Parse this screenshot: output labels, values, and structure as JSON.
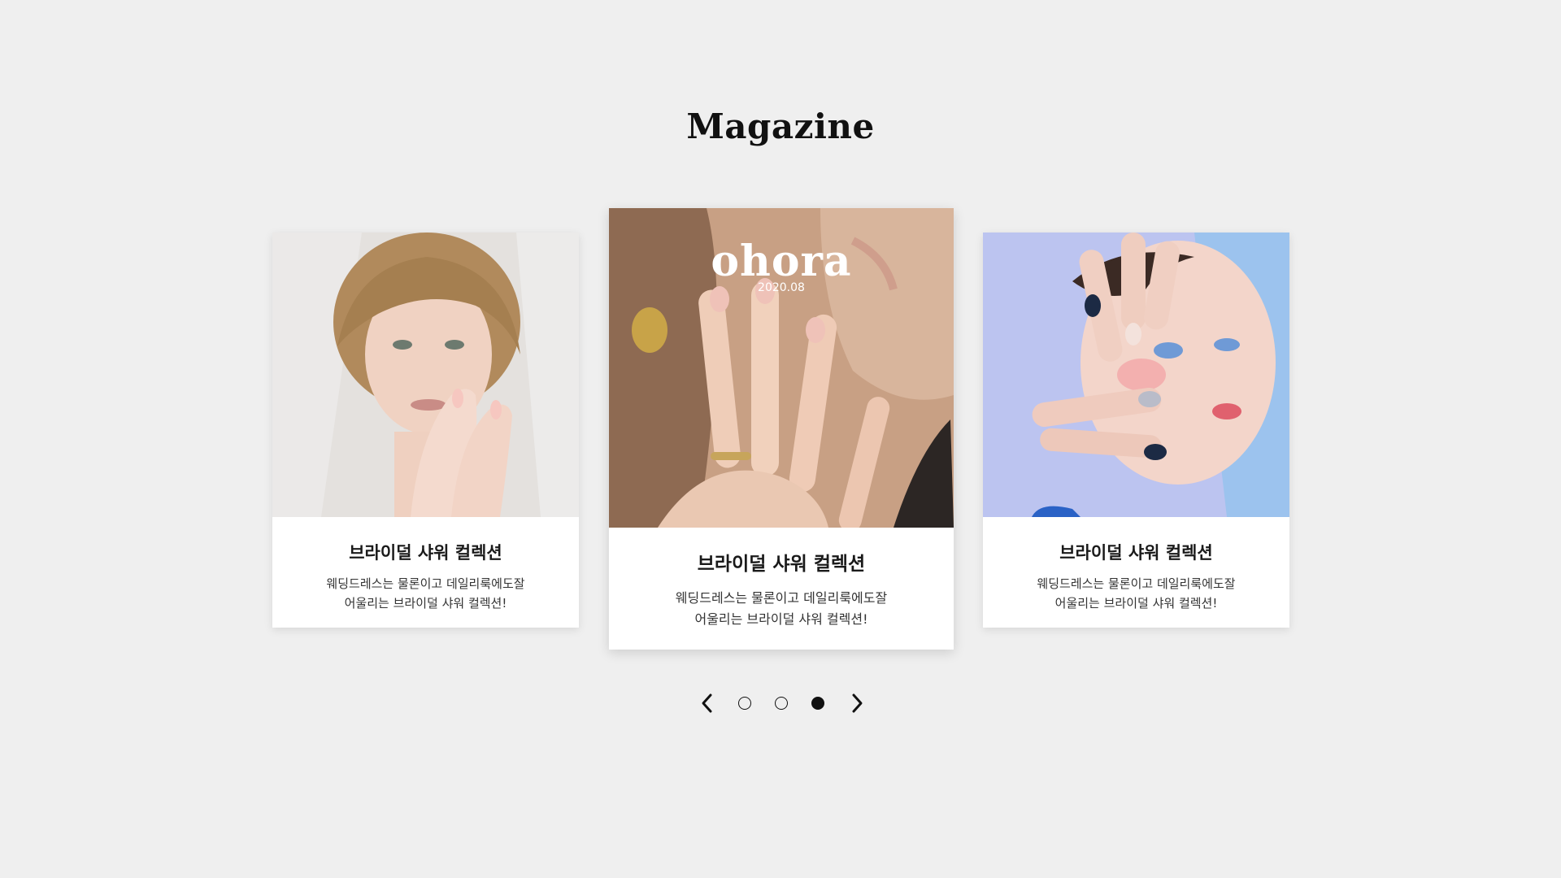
{
  "section": {
    "title": "Magazine"
  },
  "cards": [
    {
      "title": "브라이덜 샤워 컬렉션",
      "desc_line1": "웨딩드레스는 물론이고 데일리룩에도잘",
      "desc_line2": "어울리는 브라이덜 샤워 컬렉션!"
    },
    {
      "title": "브라이덜 샤워 컬렉션",
      "desc_line1": "웨딩드레스는 물론이고 데일리룩에도잘",
      "desc_line2": "어울리는 브라이덜 샤워 컬렉션!",
      "cover_logo": "ohora",
      "cover_date": "2020.08"
    },
    {
      "title": "브라이덜 샤워 컬렉션",
      "desc_line1": "웨딩드레스는 물론이고 데일리룩에도잘",
      "desc_line2": "어울리는 브라이덜 샤워 컬렉션!"
    }
  ],
  "pagination": {
    "prev_icon": "chevron-left-icon",
    "next_icon": "chevron-right-icon",
    "page_count": 3,
    "active_index": 3
  },
  "colors": {
    "background": "#efefef",
    "card": "#ffffff",
    "text": "#111111"
  }
}
